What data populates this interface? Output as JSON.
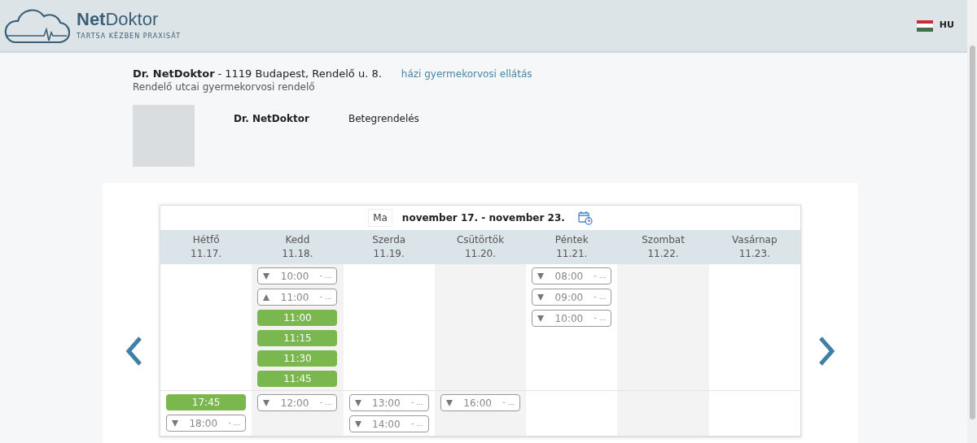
{
  "header": {
    "brand_bold": "Net",
    "brand_light": "Doktor",
    "tagline": "TARTSA KÉZBEN PRAXISÁT",
    "language": "HU"
  },
  "practice": {
    "doctor": "Dr. NetDoktor",
    "address": "- 1119 Budapest, Rendelő u. 8.",
    "service_link": "házi gyermekorvosi ellátás",
    "subtitle": "Rendelő utcai gyermekorvosi rendelő"
  },
  "profile": {
    "name": "Dr. NetDoktor",
    "type": "Betegrendelés"
  },
  "calendar": {
    "today_button": "Ma",
    "range": "november 17. - november 23.",
    "days": [
      {
        "name": "Hétfő",
        "date": "11.17."
      },
      {
        "name": "Kedd",
        "date": "11.18."
      },
      {
        "name": "Szerda",
        "date": "11.19."
      },
      {
        "name": "Csütörtök",
        "date": "11.20."
      },
      {
        "name": "Péntek",
        "date": "11.21."
      },
      {
        "name": "Szombat",
        "date": "11.22."
      },
      {
        "name": "Vasárnap",
        "date": "11.23."
      }
    ],
    "sections": [
      {
        "columns": [
          [],
          [
            {
              "kind": "group",
              "time": "10:00",
              "suffix": "- ...",
              "expanded": false
            },
            {
              "kind": "group",
              "time": "11:00",
              "suffix": "- ...",
              "expanded": true
            },
            {
              "kind": "slot",
              "time": "11:00"
            },
            {
              "kind": "slot",
              "time": "11:15"
            },
            {
              "kind": "slot",
              "time": "11:30"
            },
            {
              "kind": "slot",
              "time": "11:45"
            }
          ],
          [],
          [],
          [
            {
              "kind": "group",
              "time": "08:00",
              "suffix": "- ...",
              "expanded": false
            },
            {
              "kind": "group",
              "time": "09:00",
              "suffix": "- ...",
              "expanded": false
            },
            {
              "kind": "group",
              "time": "10:00",
              "suffix": "- ...",
              "expanded": false
            }
          ],
          [],
          []
        ]
      },
      {
        "columns": [
          [
            {
              "kind": "slot",
              "time": "17:45"
            },
            {
              "kind": "group",
              "time": "18:00",
              "suffix": "- ...",
              "expanded": false
            }
          ],
          [
            {
              "kind": "group",
              "time": "12:00",
              "suffix": "- ...",
              "expanded": false
            }
          ],
          [
            {
              "kind": "group",
              "time": "13:00",
              "suffix": "- ...",
              "expanded": false
            },
            {
              "kind": "group",
              "time": "14:00",
              "suffix": "- ...",
              "expanded": false
            }
          ],
          [
            {
              "kind": "group",
              "time": "16:00",
              "suffix": "- ...",
              "expanded": false
            }
          ],
          [],
          [],
          []
        ]
      }
    ]
  }
}
